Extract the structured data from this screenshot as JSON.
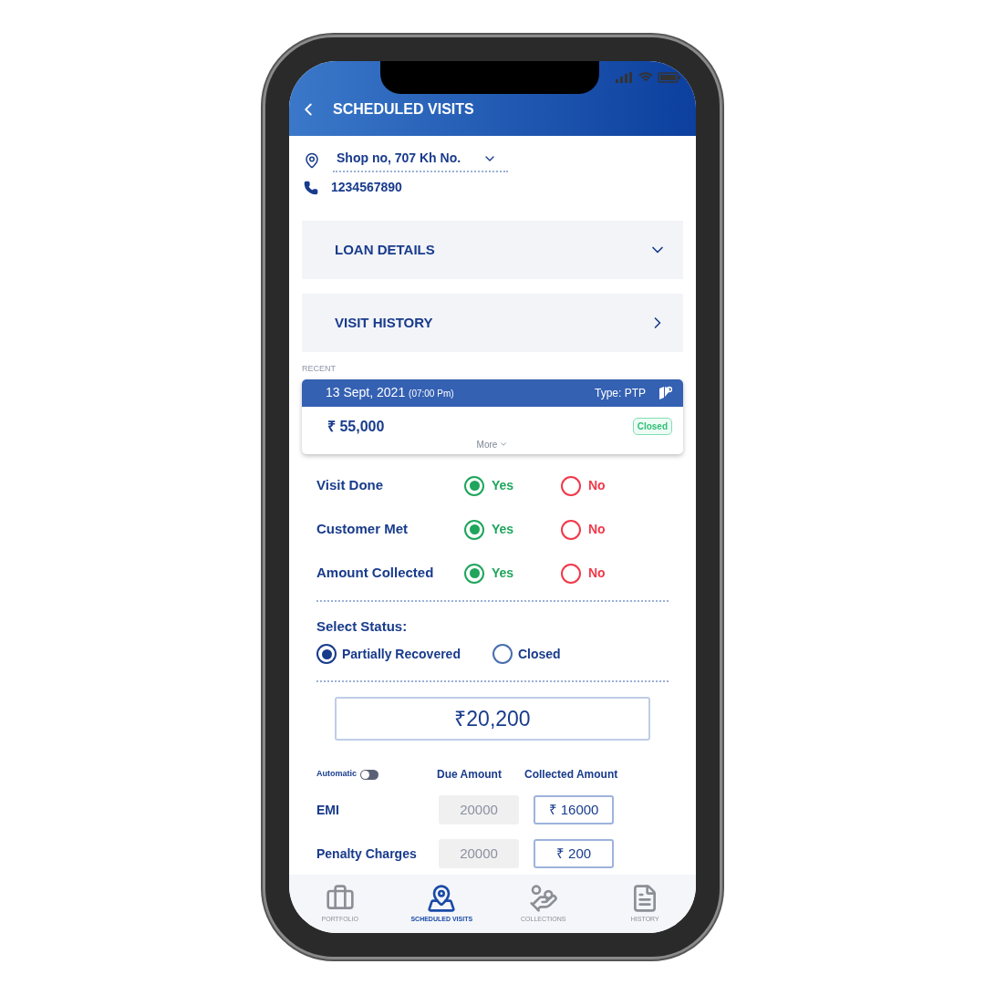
{
  "header": {
    "title": "SCHEDULED VISITS"
  },
  "contact": {
    "address": "Shop no, 707 Kh No.",
    "phone": "1234567890"
  },
  "sections": [
    {
      "label": "LOAN DETAILS",
      "kind": "expand"
    },
    {
      "label": "VISIT HISTORY",
      "kind": "link"
    }
  ],
  "recent": {
    "label": "RECENT",
    "date": "13 Sept, 2021",
    "time": "(07:00 Pm)",
    "type": "Type: PTP",
    "amount": "₹ 55,000",
    "status": "Closed",
    "more": "More"
  },
  "questions": [
    {
      "label": "Visit Done",
      "options": [
        {
          "label": "Yes",
          "kind": "yes",
          "selected": true
        },
        {
          "label": "No",
          "kind": "no",
          "selected": false
        }
      ]
    },
    {
      "label": "Customer Met",
      "options": [
        {
          "label": "Yes",
          "kind": "yes",
          "selected": true
        },
        {
          "label": "No",
          "kind": "no",
          "selected": false
        }
      ]
    },
    {
      "label": "Amount Collected",
      "options": [
        {
          "label": "Yes",
          "kind": "yes",
          "selected": true
        },
        {
          "label": "No",
          "kind": "no",
          "selected": false
        }
      ]
    }
  ],
  "status": {
    "label": "Select Status:",
    "options": [
      {
        "label": "Partially Recovered",
        "selected": true
      },
      {
        "label": "Closed",
        "selected": false
      }
    ]
  },
  "total": {
    "value": "₹20,200"
  },
  "table": {
    "automatic": {
      "label": "Automatic",
      "on": false
    },
    "columns": [
      "Due Amount",
      "Collected Amount"
    ],
    "rows": [
      {
        "label": "EMI",
        "due": "20000",
        "collected": "₹ 16000"
      },
      {
        "label": "Penalty Charges",
        "due": "20000",
        "collected": "₹ 200"
      }
    ]
  },
  "nav": [
    {
      "label": "PORTFOLIO",
      "kind": "briefcase",
      "selected": false
    },
    {
      "label": "SCHEDULED VISITS",
      "kind": "pin",
      "selected": true
    },
    {
      "label": "COLLECTIONS",
      "kind": "cash",
      "selected": false
    },
    {
      "label": "HISTORY",
      "kind": "doc",
      "selected": false
    }
  ]
}
